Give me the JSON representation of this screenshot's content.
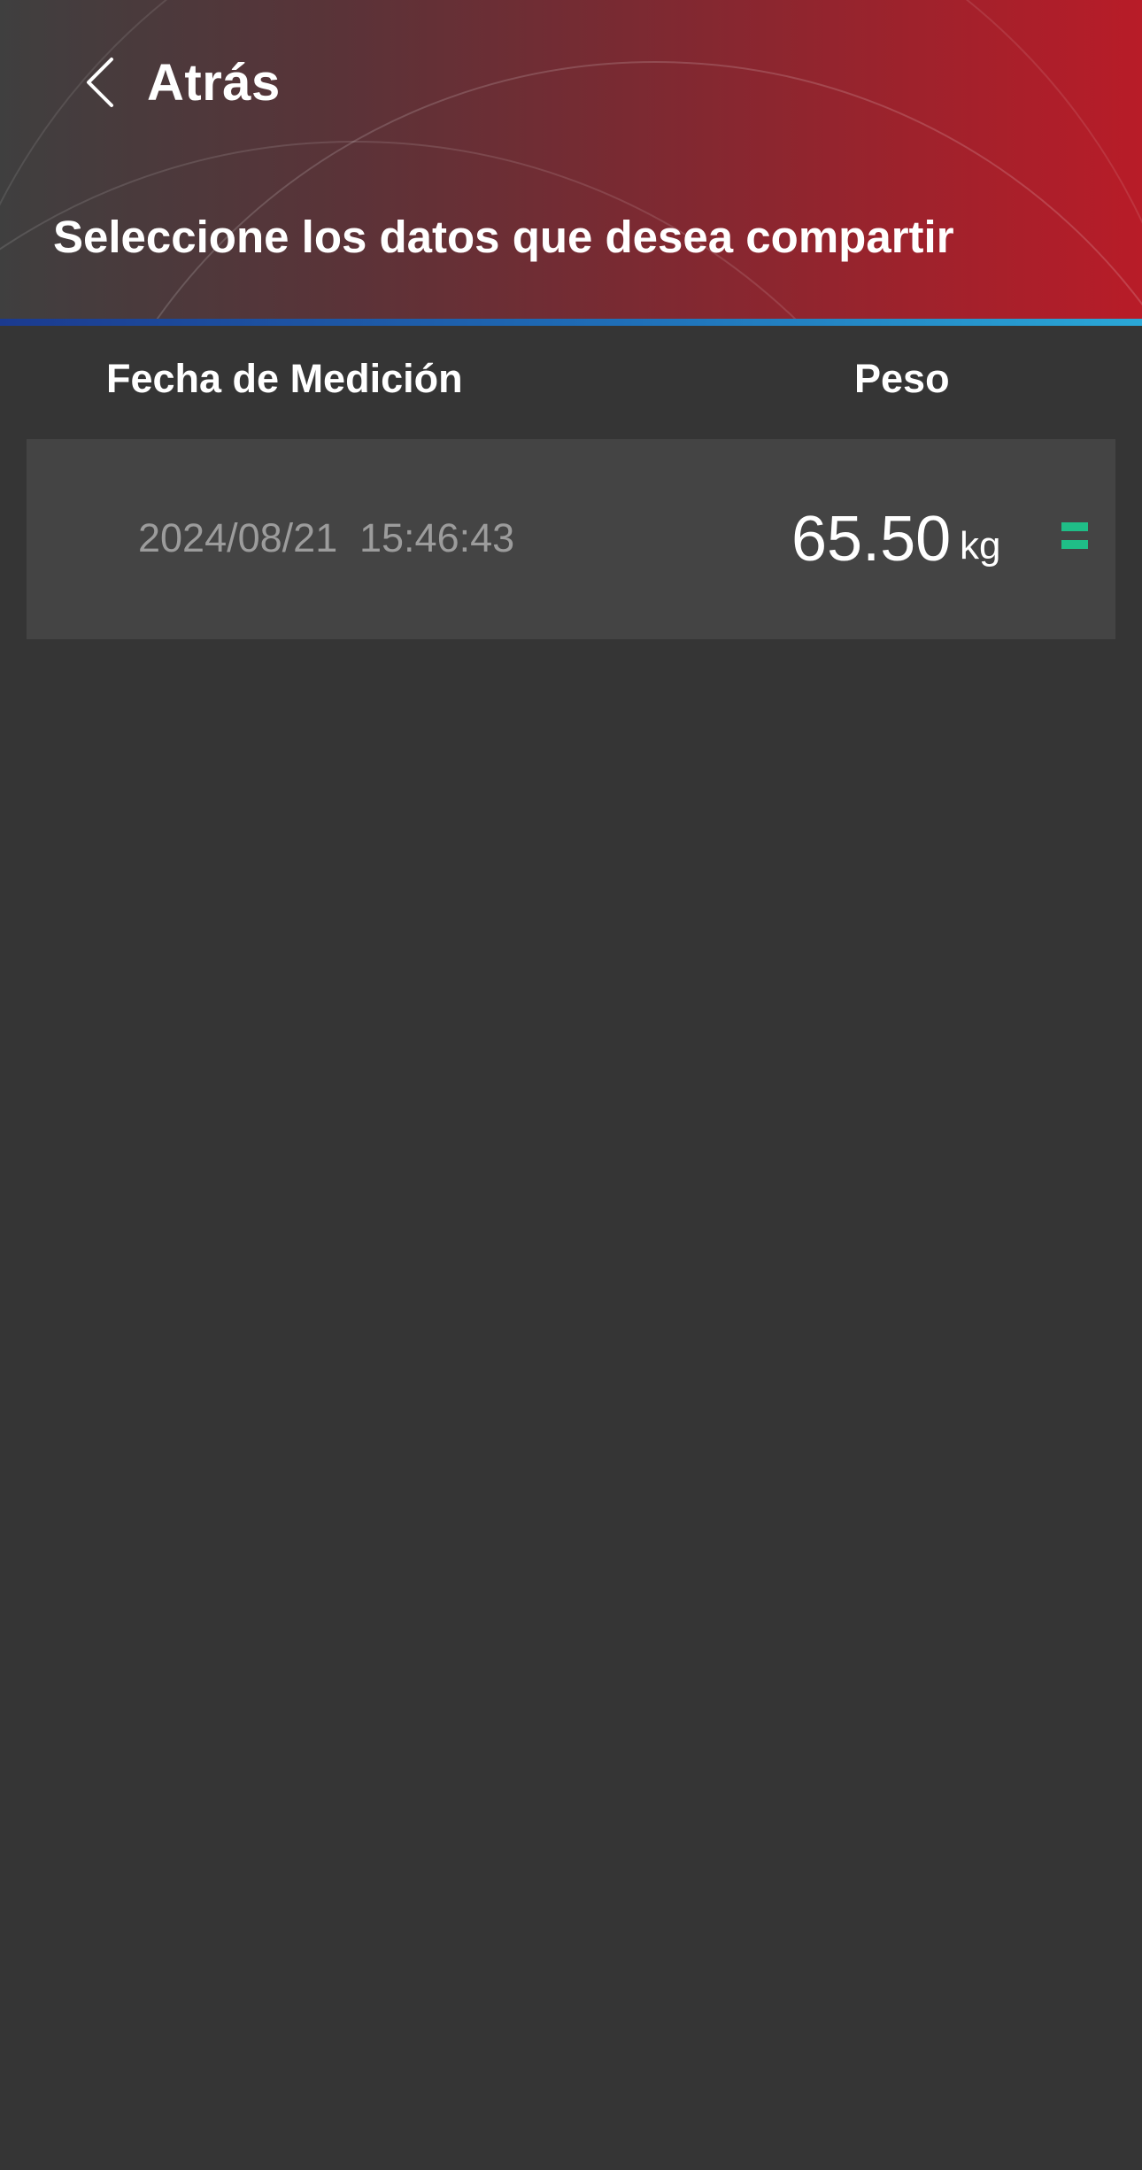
{
  "header": {
    "back_label": "Atrás",
    "subtitle": "Seleccione los datos que desea compartir",
    "gradient_colors": [
      "#3f3f3f",
      "#b81c28"
    ],
    "divider_colors": [
      "#1b3a8f",
      "#2aa7d6"
    ]
  },
  "table": {
    "columns": {
      "date": "Fecha de Medición",
      "weight": "Peso"
    },
    "rows": [
      {
        "date": "2024/08/21",
        "time": "15:46:43",
        "weight": "65.50",
        "unit": "kg",
        "trend_icon": "equal-icon",
        "trend_color": "#1fbe87"
      }
    ]
  },
  "background_color": "#353535"
}
